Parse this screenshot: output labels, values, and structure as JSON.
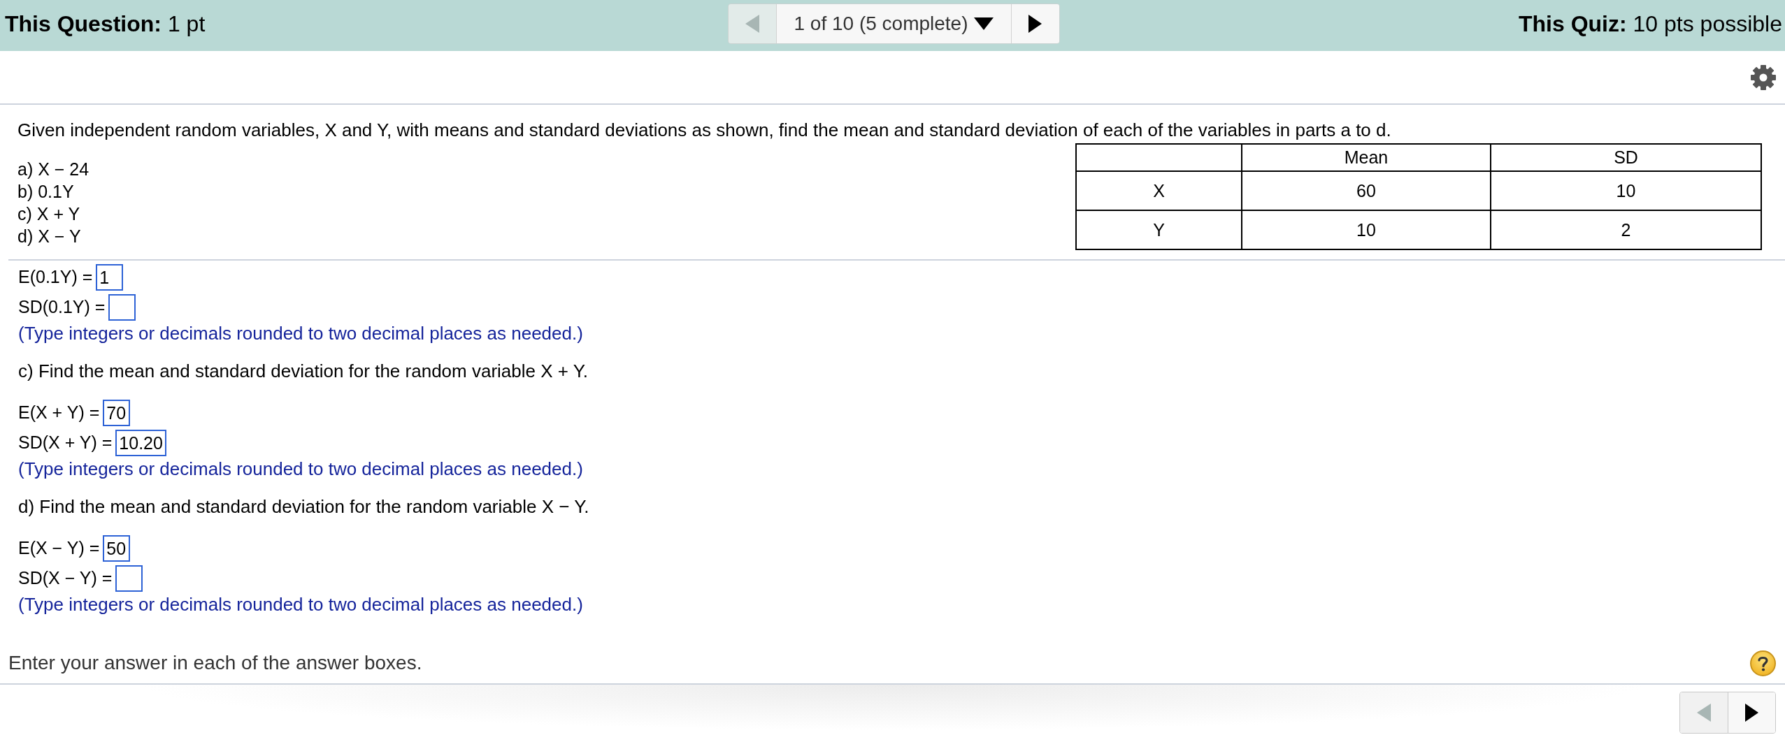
{
  "top_bar": {
    "question_points": "**This Question:** 1 pt",
    "pager": {
      "prev_disabled": true,
      "position": "1 of 10 (5 complete)",
      "next_disabled": false
    },
    "quiz_points": "**This Quiz:** 10 pts possible"
  },
  "question": {
    "stem": "Given independent random variables, X and Y, with means and standard deviations as shown, find the mean and standard deviation of each of the variables in parts a to d.",
    "parts": [
      "a) X − 24",
      "b) 0.1Y",
      "c) X + Y",
      "d) X − Y"
    ],
    "table": {
      "columns": [
        "Mean",
        "SD"
      ],
      "rows": [
        {
          "label": "X",
          "cells": [
            "60",
            "10"
          ]
        },
        {
          "label": "Y",
          "cells": [
            "10",
            "2"
          ]
        }
      ]
    }
  },
  "work": [
    {
      "kind": "answer",
      "label": "E(0.1Y) =",
      "value": "1"
    },
    {
      "kind": "answer",
      "label": "SD(0.1Y) ="
    },
    {
      "kind": "note",
      "text": "(Type integers or decimals rounded to two decimal places as needed.)"
    },
    {
      "kind": "prompt",
      "text": "c) Find the mean and standard deviation for the random variable X + Y."
    },
    {
      "kind": "answer",
      "label": "E(X + Y) =",
      "value": "70"
    },
    {
      "kind": "answer",
      "label": "SD(X + Y) =",
      "value": "10.20"
    },
    {
      "kind": "note",
      "text": "(Type integers or decimals rounded to two decimal places as needed.)"
    },
    {
      "kind": "prompt",
      "text": "d) Find the mean and standard deviation for the random variable X − Y."
    },
    {
      "kind": "answer",
      "label": "E(X − Y) =",
      "value": "50"
    },
    {
      "kind": "answer",
      "label": "SD(X − Y) ="
    },
    {
      "kind": "note",
      "text": "(Type integers or decimals rounded to two decimal places as needed.)"
    }
  ],
  "footer": {
    "instruction": "Enter your answer in each of the answer boxes."
  },
  "bottom_pager": {
    "prev_disabled": true,
    "next_disabled": false
  }
}
